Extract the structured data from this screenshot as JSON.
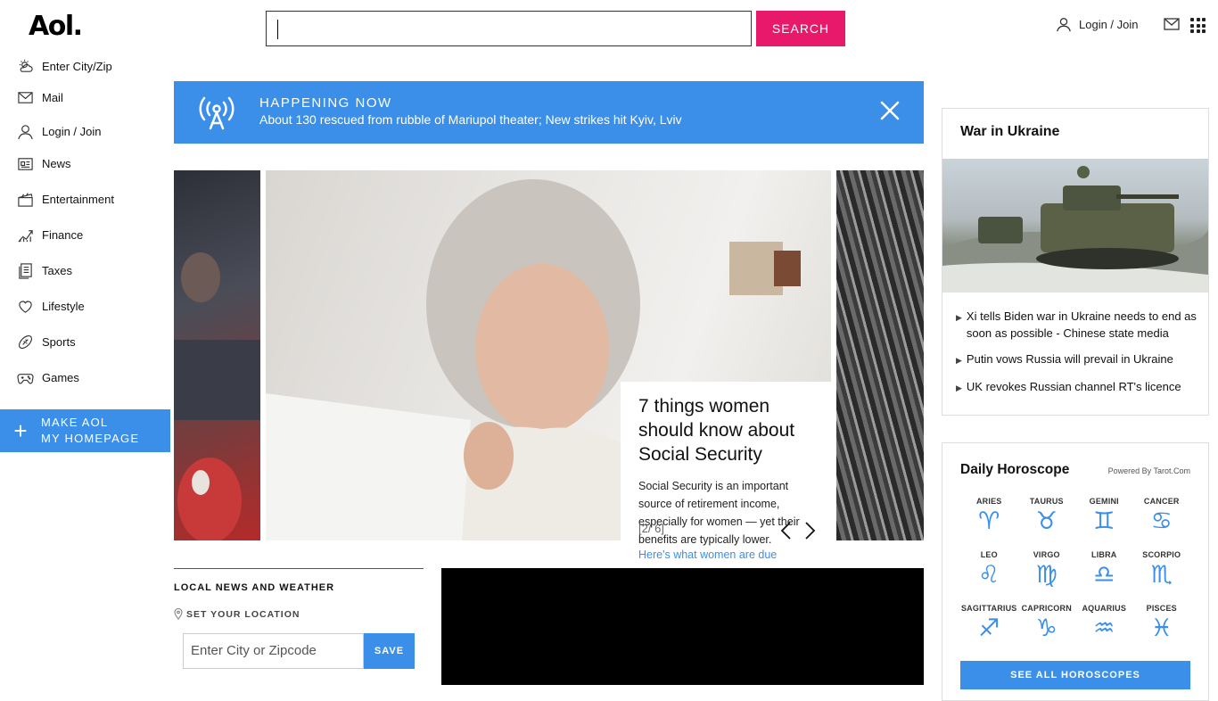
{
  "header": {
    "logo": "Aol.",
    "search_placeholder": "",
    "search_label": "SEARCH",
    "login_label": "Login / Join"
  },
  "sidebar": {
    "items": [
      {
        "label": "Enter City/Zip",
        "icon": "weather-icon"
      },
      {
        "label": "Mail",
        "icon": "mail-icon"
      },
      {
        "label": "Login / Join",
        "icon": "user-icon"
      },
      {
        "label": "News",
        "icon": "news-icon"
      },
      {
        "label": "Entertainment",
        "icon": "clapper-icon"
      },
      {
        "label": "Finance",
        "icon": "chart-icon"
      },
      {
        "label": "Taxes",
        "icon": "document-icon"
      },
      {
        "label": "Lifestyle",
        "icon": "heart-icon"
      },
      {
        "label": "Sports",
        "icon": "football-icon"
      },
      {
        "label": "Games",
        "icon": "gamepad-icon"
      }
    ],
    "make_homepage_line1": "MAKE AOL",
    "make_homepage_line2": "MY HOMEPAGE"
  },
  "banner": {
    "title": "HAPPENING NOW",
    "text": "About 130 rescued from rubble of Mariupol theater; New strikes hit Kyiv, Lviv"
  },
  "carousel": {
    "headline": "7 things women should know about Social Security",
    "summary": "Social Security is an important source of retirement income, especially for women — yet their benefits are typically lower.",
    "link": "Here's what women are due",
    "counter": "[2/ 6]"
  },
  "local": {
    "title": "LOCAL NEWS AND WEATHER",
    "set_location": "SET YOUR LOCATION",
    "input_placeholder": "Enter City or Zipcode",
    "save_label": "SAVE"
  },
  "war": {
    "title": "War in Ukraine",
    "items": [
      "Xi tells Biden war in Ukraine needs to end as soon as possible - Chinese state media",
      "Putin vows Russia will prevail in Ukraine",
      "UK revokes Russian channel RT's licence"
    ]
  },
  "horoscope": {
    "title": "Daily Horoscope",
    "powered_by": "Powered By Tarot.Com",
    "signs": [
      {
        "name": "ARIES",
        "glyph": "♈"
      },
      {
        "name": "TAURUS",
        "glyph": "♉"
      },
      {
        "name": "GEMINI",
        "glyph": "♊"
      },
      {
        "name": "CANCER",
        "glyph": "♋"
      },
      {
        "name": "LEO",
        "glyph": "♌"
      },
      {
        "name": "VIRGO",
        "glyph": "♍"
      },
      {
        "name": "LIBRA",
        "glyph": "♎"
      },
      {
        "name": "SCORPIO",
        "glyph": "♏"
      },
      {
        "name": "SAGITTARIUS",
        "glyph": "♐"
      },
      {
        "name": "CAPRICORN",
        "glyph": "♑"
      },
      {
        "name": "AQUARIUS",
        "glyph": "♒"
      },
      {
        "name": "PISCES",
        "glyph": "♓"
      }
    ],
    "see_all": "SEE ALL HOROSCOPES"
  },
  "colors": {
    "accent_blue": "#3b8fe8",
    "search_pink": "#e8196b"
  }
}
